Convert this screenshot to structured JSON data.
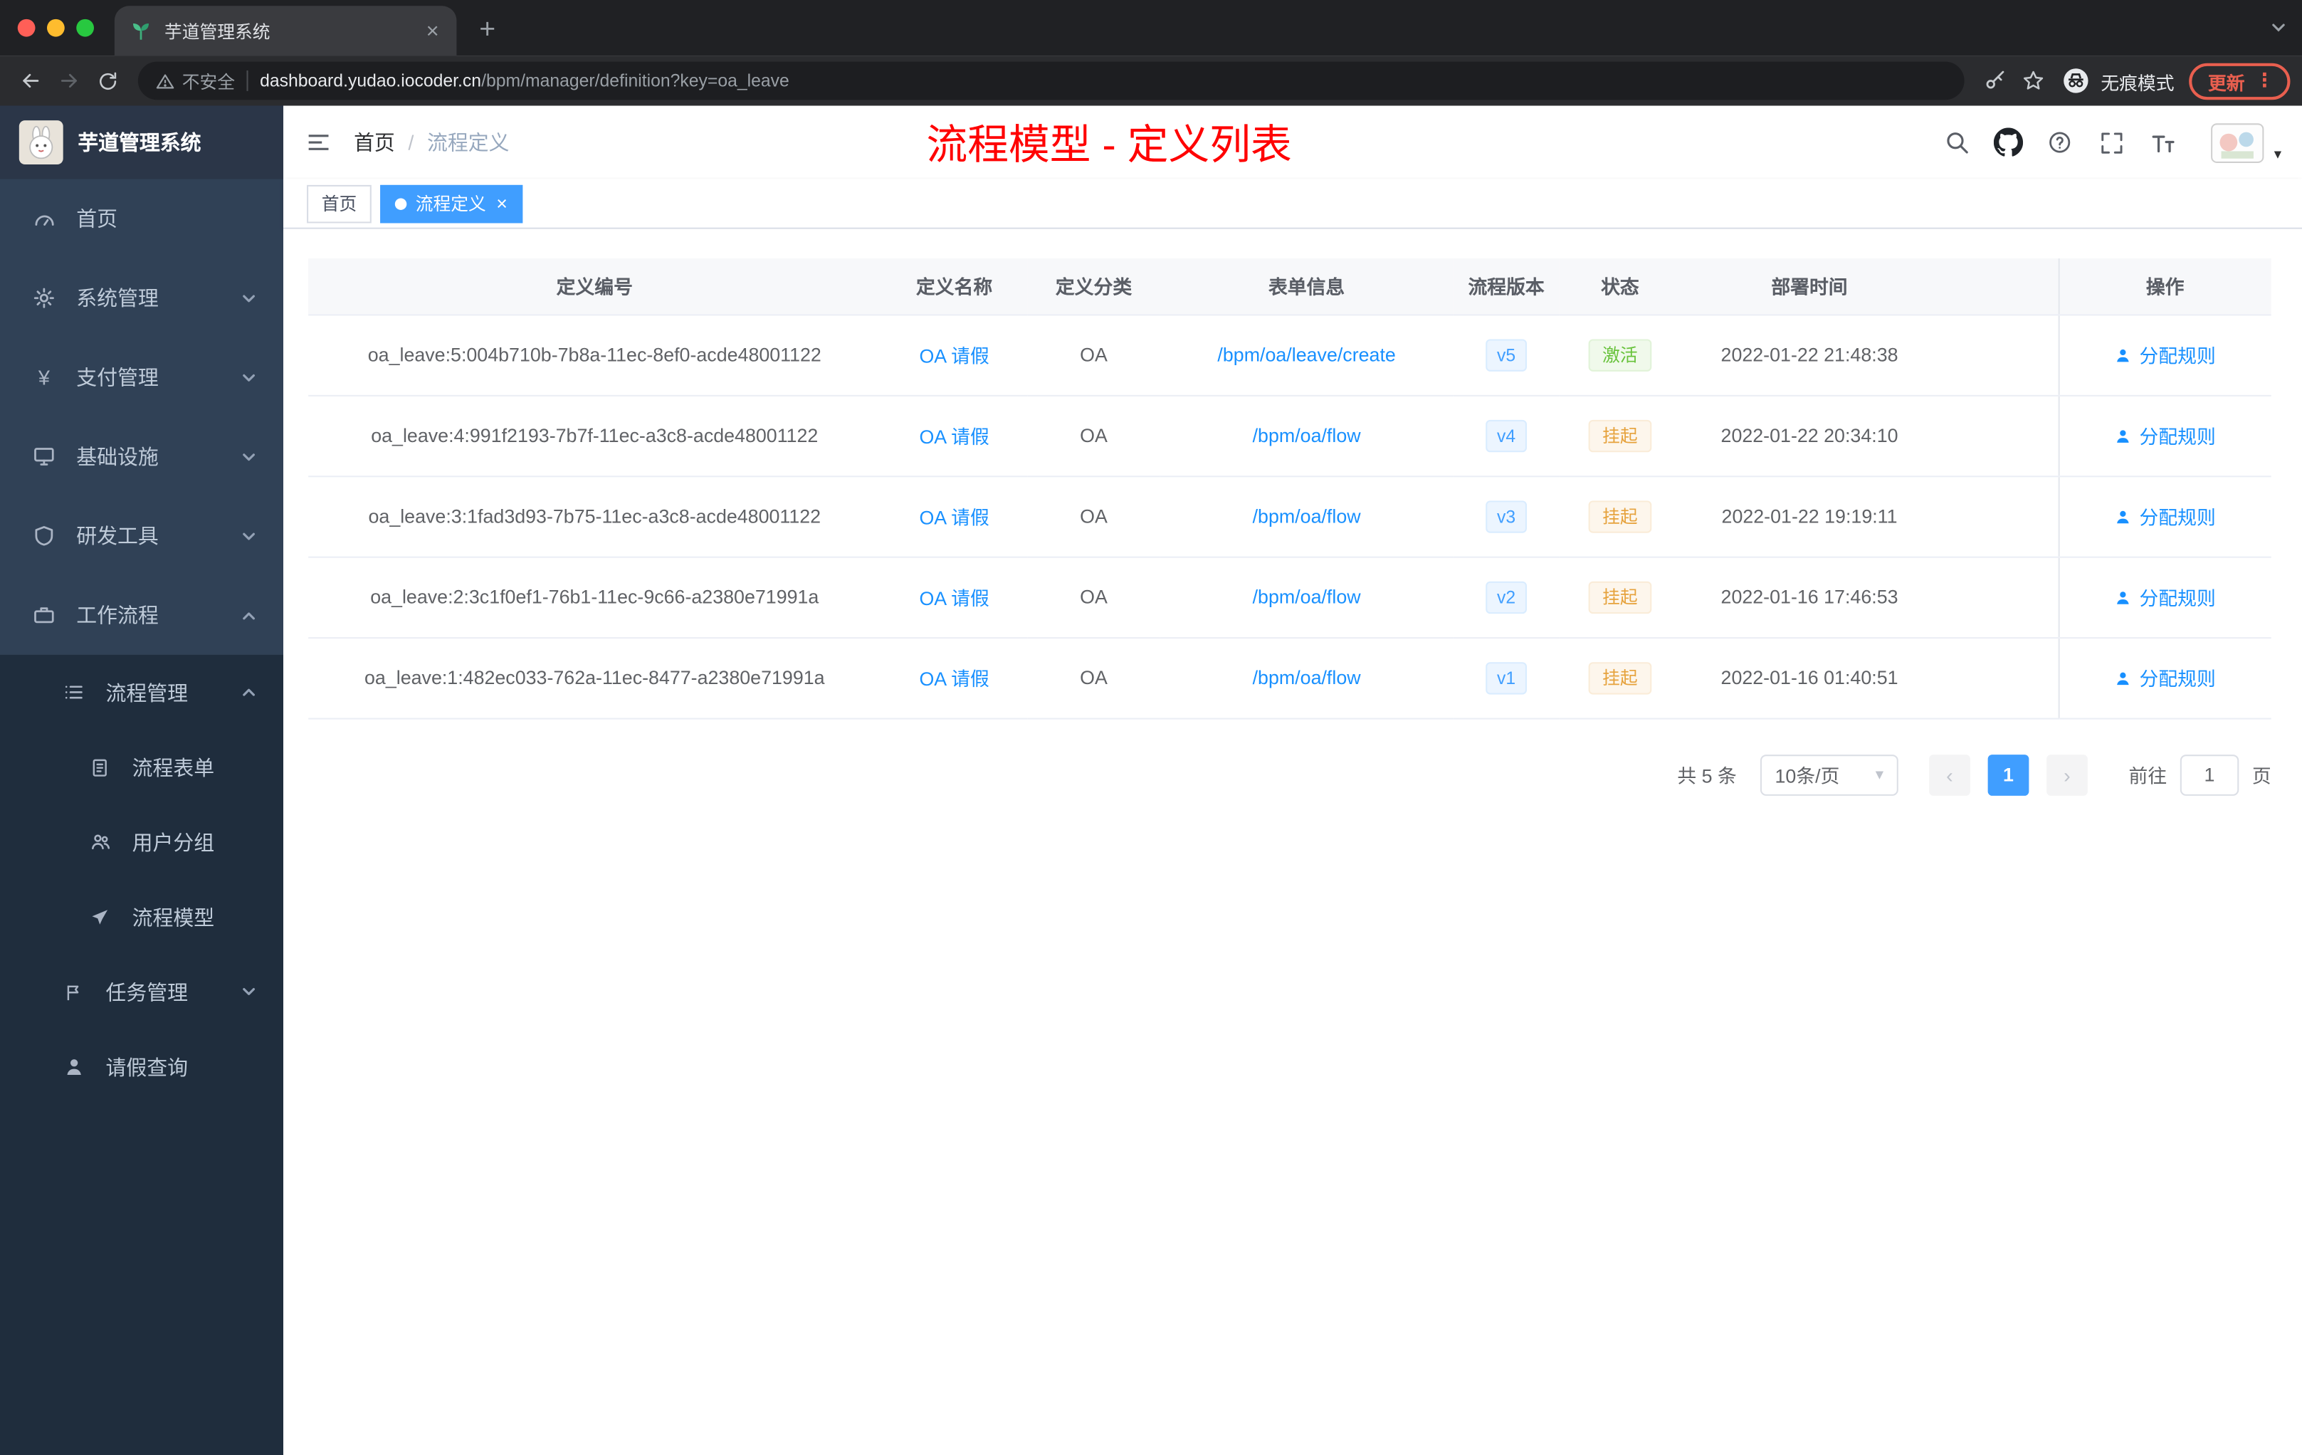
{
  "browser": {
    "tab_title": "芋道管理系统",
    "security_label": "不安全",
    "url_host": "dashboard.yudao.iocoder.cn",
    "url_path": "/bpm/manager/definition?key=oa_leave",
    "incognito_label": "无痕模式",
    "update_label": "更新"
  },
  "icons": {
    "close": "×",
    "plus": "+",
    "kebab": "⋮",
    "yen": "¥",
    "caret_down": "▾",
    "chevron_left": "‹",
    "chevron_right": "›",
    "slash": "/"
  },
  "sidebar": {
    "logo_title": "芋道管理系统",
    "items": [
      {
        "label": "首页"
      },
      {
        "label": "系统管理"
      },
      {
        "label": "支付管理"
      },
      {
        "label": "基础设施"
      },
      {
        "label": "研发工具"
      },
      {
        "label": "工作流程"
      }
    ],
    "submenu": [
      {
        "label": "流程管理"
      },
      {
        "label": "流程表单"
      },
      {
        "label": "用户分组"
      },
      {
        "label": "流程模型"
      },
      {
        "label": "任务管理"
      },
      {
        "label": "请假查询"
      }
    ]
  },
  "header": {
    "breadcrumb_home": "首页",
    "breadcrumb_current": "流程定义",
    "annotation": "流程模型 - 定义列表"
  },
  "tags": {
    "home": "首页",
    "active": "流程定义"
  },
  "table": {
    "columns": [
      "定义编号",
      "定义名称",
      "定义分类",
      "表单信息",
      "流程版本",
      "状态",
      "部署时间",
      "操作"
    ],
    "rows": [
      {
        "id": "oa_leave:5:004b710b-7b8a-11ec-8ef0-acde48001122",
        "name": "OA 请假",
        "category": "OA",
        "form": "/bpm/oa/leave/create",
        "version": "v5",
        "status": "激活",
        "status_type": "success",
        "time": "2022-01-22 21:48:38",
        "action": "分配规则"
      },
      {
        "id": "oa_leave:4:991f2193-7b7f-11ec-a3c8-acde48001122",
        "name": "OA 请假",
        "category": "OA",
        "form": "/bpm/oa/flow",
        "version": "v4",
        "status": "挂起",
        "status_type": "warning",
        "time": "2022-01-22 20:34:10",
        "action": "分配规则"
      },
      {
        "id": "oa_leave:3:1fad3d93-7b75-11ec-a3c8-acde48001122",
        "name": "OA 请假",
        "category": "OA",
        "form": "/bpm/oa/flow",
        "version": "v3",
        "status": "挂起",
        "status_type": "warning",
        "time": "2022-01-22 19:19:11",
        "action": "分配规则"
      },
      {
        "id": "oa_leave:2:3c1f0ef1-76b1-11ec-9c66-a2380e71991a",
        "name": "OA 请假",
        "category": "OA",
        "form": "/bpm/oa/flow",
        "version": "v2",
        "status": "挂起",
        "status_type": "warning",
        "time": "2022-01-16 17:46:53",
        "action": "分配规则"
      },
      {
        "id": "oa_leave:1:482ec033-762a-11ec-8477-a2380e71991a",
        "name": "OA 请假",
        "category": "OA",
        "form": "/bpm/oa/flow",
        "version": "v1",
        "status": "挂起",
        "status_type": "warning",
        "time": "2022-01-16 01:40:51",
        "action": "分配规则"
      }
    ]
  },
  "pagination": {
    "total": "共 5 条",
    "page_size": "10条/页",
    "current": "1",
    "goto": "前往",
    "goto_value": "1",
    "unit": "页"
  }
}
